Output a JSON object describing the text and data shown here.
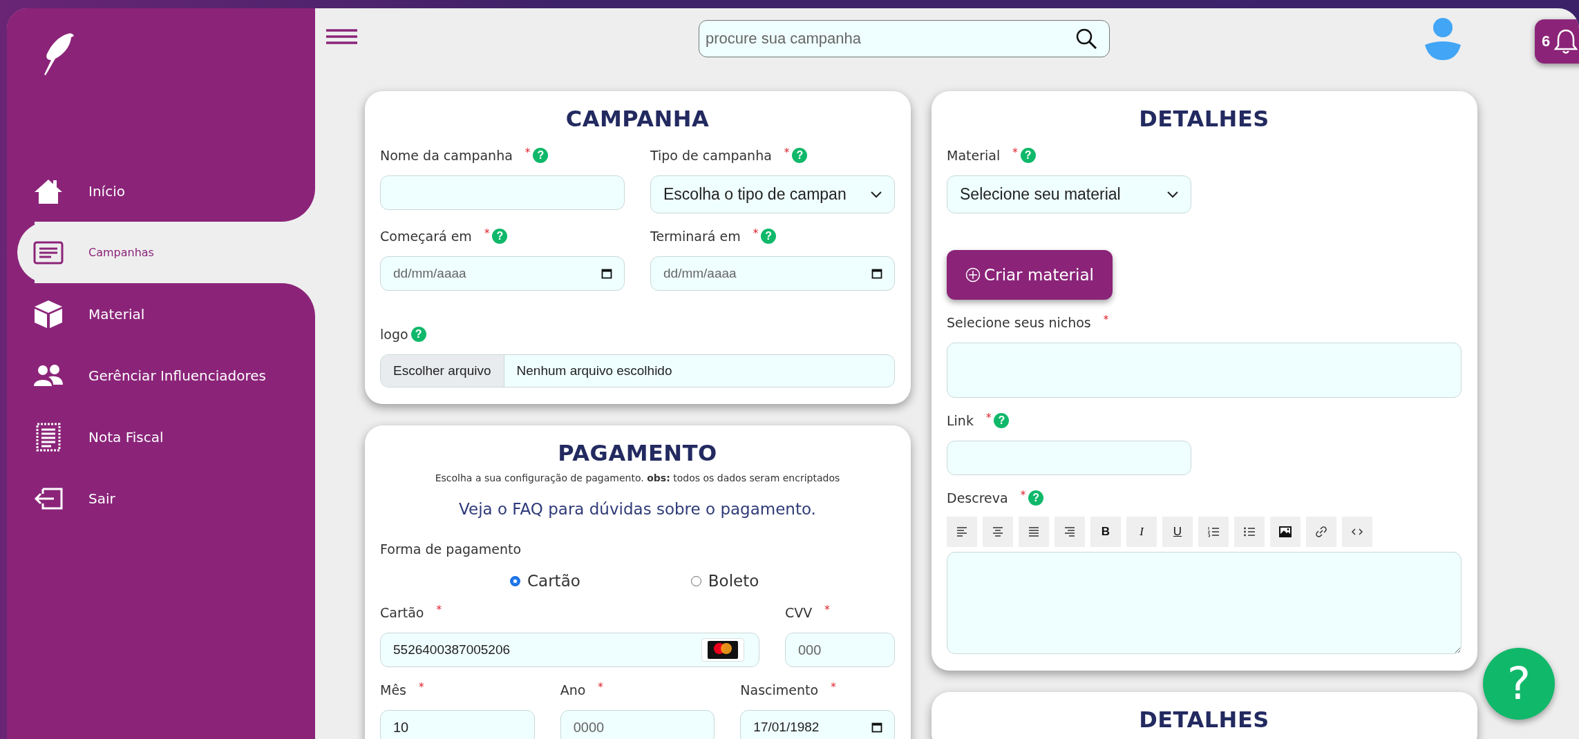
{
  "sidebar": {
    "items": [
      {
        "kind": "home",
        "label": "Início",
        "selected": false
      },
      {
        "kind": "list",
        "label": "Campanhas",
        "selected": true
      },
      {
        "kind": "box",
        "label": "Material",
        "selected": false
      },
      {
        "kind": "people",
        "label": "Gerênciar Influenciadores",
        "selected": false
      },
      {
        "kind": "receipt",
        "label": "Nota Fiscal",
        "selected": false
      },
      {
        "kind": "exit",
        "label": "Sair",
        "selected": false
      }
    ]
  },
  "topbar": {
    "search": {
      "placeholder": "procure sua campanha"
    },
    "notifications": {
      "count": "6"
    }
  },
  "columns": [
    [
      {
        "title": "CAMPANHA",
        "groups": [
          {
            "fields": [
              {
                "kind": "text",
                "label": "Nome da campanha",
                "required": "*",
                "help": "?"
              },
              {
                "kind": "select",
                "label": "Tipo de campanha",
                "required": "*",
                "help": "?",
                "value": "Escolha o tipo de campan"
              }
            ]
          },
          {
            "fields": [
              {
                "kind": "date",
                "label": "Começará em",
                "required": "*",
                "help": "?",
                "placeholder": "dd/mm/aaaa"
              },
              {
                "kind": "date",
                "label": "Terminará em",
                "required": "*",
                "help": "?",
                "placeholder": "dd/mm/aaaa"
              }
            ]
          },
          {
            "fields": [
              {
                "kind": "file",
                "label": "logo",
                "help": "?",
                "button": "Escolher arquivo",
                "status": "Nenhum arquivo escolhido"
              }
            ]
          }
        ]
      },
      {
        "title": "PAGAMENTO",
        "subtitle": "Escolha a sua configuração de pagamento. **obs:** todos os dados seram encriptados",
        "faq": "Veja o FAQ para dúvidas sobre o pagamento.",
        "groups": [
          {
            "fields": [
              {
                "kind": "radio",
                "label": "Forma de pagamento",
                "options": [
                  {
                    "label": "Cartão",
                    "selected": true
                  },
                  {
                    "label": "Boleto",
                    "selected": false
                  }
                ]
              }
            ]
          },
          {
            "fields": [
              {
                "kind": "card",
                "label": "Cartão",
                "required": "*",
                "value": "5526400387005206"
              },
              {
                "kind": "text",
                "label": "CVV",
                "required": "*",
                "placeholder": "000"
              }
            ]
          },
          {
            "fields": [
              {
                "kind": "text",
                "label": "Mês",
                "required": "*",
                "value": "10"
              },
              {
                "kind": "text",
                "label": "Ano",
                "required": "*",
                "placeholder": "0000"
              },
              {
                "kind": "date",
                "label": "Nascimento",
                "required": "*",
                "value": "17/01/1982"
              }
            ]
          }
        ]
      }
    ],
    [
      {
        "title": "DETALHES",
        "groups": [
          {
            "fields": [
              {
                "kind": "select",
                "label": "Material",
                "required": "*",
                "help": "?",
                "value": "Selecione seu material"
              }
            ]
          },
          {
            "fields": [
              {
                "kind": "button",
                "label": "Criar material"
              }
            ]
          },
          {
            "fields": [
              {
                "kind": "tags",
                "label": "Selecione seus nichos",
                "required": "*"
              }
            ]
          },
          {
            "fields": [
              {
                "kind": "text",
                "label": "Link",
                "required": "*",
                "help": "?"
              }
            ]
          },
          {
            "fields": [
              {
                "kind": "editor",
                "label": "Descreva",
                "required": "*",
                "help": "?",
                "tools": [
                  {
                    "kind": "align-left"
                  },
                  {
                    "kind": "align-center"
                  },
                  {
                    "kind": "justify"
                  },
                  {
                    "kind": "align-right"
                  },
                  {
                    "kind": "bold",
                    "text": "B"
                  },
                  {
                    "kind": "italic",
                    "text": "I"
                  },
                  {
                    "kind": "underline",
                    "text": "U"
                  },
                  {
                    "kind": "ordered-list"
                  },
                  {
                    "kind": "bullet-list"
                  },
                  {
                    "kind": "image"
                  },
                  {
                    "kind": "link"
                  },
                  {
                    "kind": "code"
                  }
                ]
              }
            ]
          }
        ]
      },
      {
        "title": "DETALHES"
      }
    ]
  ],
  "help_button": {
    "label": "?"
  }
}
